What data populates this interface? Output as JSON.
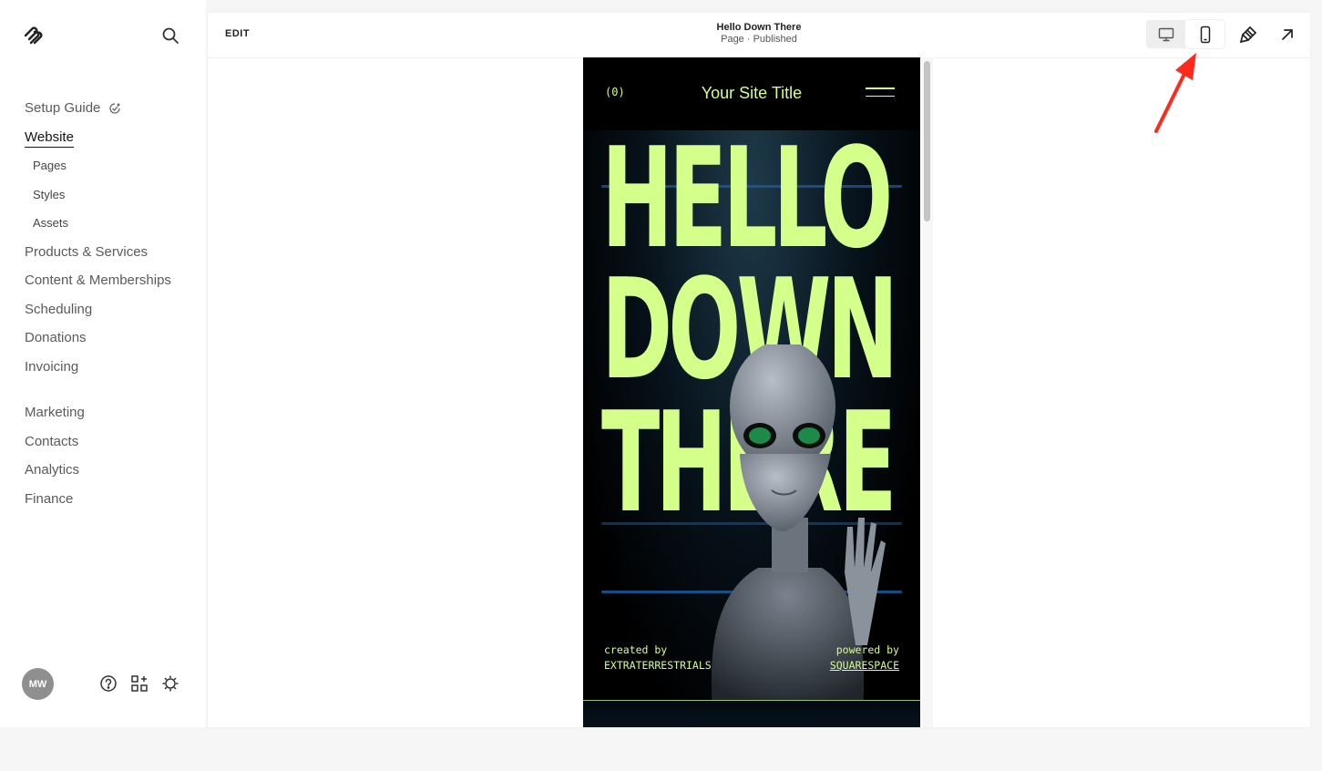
{
  "sidebar": {
    "logo": "squarespace-logo",
    "search_icon": "search-icon",
    "items": [
      {
        "label": "Setup Guide",
        "type": "main",
        "icon": "setup-progress-icon"
      },
      {
        "label": "Website",
        "type": "main",
        "active": true
      },
      {
        "label": "Pages",
        "type": "sub"
      },
      {
        "label": "Styles",
        "type": "sub"
      },
      {
        "label": "Assets",
        "type": "sub"
      },
      {
        "label": "Products & Services",
        "type": "main"
      },
      {
        "label": "Content & Memberships",
        "type": "main"
      },
      {
        "label": "Scheduling",
        "type": "main"
      },
      {
        "label": "Donations",
        "type": "main"
      },
      {
        "label": "Invoicing",
        "type": "main"
      },
      {
        "label": "Marketing",
        "type": "main"
      },
      {
        "label": "Contacts",
        "type": "main"
      },
      {
        "label": "Analytics",
        "type": "main"
      },
      {
        "label": "Finance",
        "type": "main"
      }
    ],
    "footer": {
      "avatar_initials": "MW",
      "icons": [
        "help-icon",
        "add-block-icon",
        "settings-icon"
      ]
    }
  },
  "editor": {
    "edit_label": "EDIT",
    "page_title": "Hello Down There",
    "page_status": "Page · Published",
    "view_toggle": {
      "options": [
        "desktop",
        "mobile"
      ],
      "selected": "mobile"
    },
    "toolbar_icons": [
      "site-styles-icon",
      "open-external-icon"
    ]
  },
  "preview": {
    "cart_label": "(0)",
    "site_title": "Your Site Title",
    "headline_lines": [
      "HELLO",
      "DOWN",
      "THERE"
    ],
    "credit_left_top": "created by",
    "credit_left_bottom": "EXTRATERRESTRIALS",
    "credit_right_top": "powered by",
    "credit_right_link": "SQUARESPACE",
    "accent_color": "#d4ff8a"
  },
  "annotation": {
    "type": "red-arrow",
    "points_to": "mobile-view-button",
    "color": "#ff2a1a"
  }
}
